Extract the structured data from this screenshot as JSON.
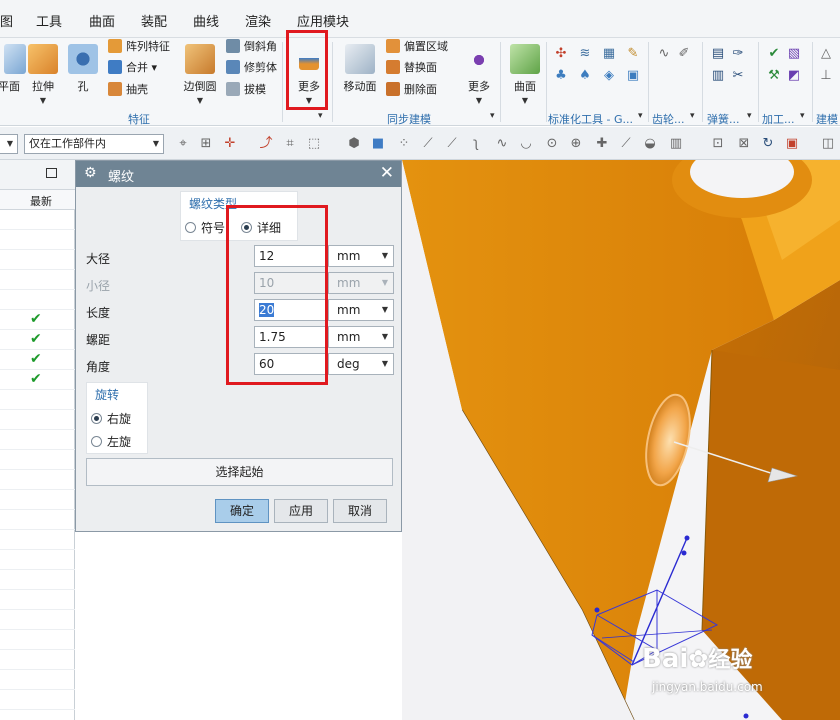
{
  "menu": [
    "图",
    "工具",
    "曲面",
    "装配",
    "曲线",
    "渲染",
    "应用模块"
  ],
  "ribbon": {
    "big_buttons": [
      "平面",
      "拉伸",
      "孔",
      "边倒圆",
      "更多",
      "移动面",
      "更多",
      "曲面"
    ],
    "small_buttons": {
      "feature_col": [
        "阵列特征",
        "合并",
        "抽壳"
      ],
      "detail_col": [
        "倒斜角",
        "修剪体",
        "拔模"
      ],
      "sync_col": [
        "偏置区域",
        "替换面",
        "删除面"
      ]
    },
    "groups": [
      "特征",
      "同步建模",
      "标准化工具 - G...",
      "齿轮...",
      "弹簧...",
      "加工...",
      "建模"
    ]
  },
  "toolbar": {
    "filter_left": "",
    "scope": "仅在工作部件内"
  },
  "navigator": {
    "column_header": "最新",
    "checked_rows": 4
  },
  "dialog": {
    "title": "螺纹",
    "thread_type": {
      "title": "螺纹类型",
      "option_symbol": "符号",
      "option_detail": "详细",
      "selected": "详细"
    },
    "fields": [
      {
        "label": "大径",
        "value": "12",
        "unit": "mm",
        "enabled": true
      },
      {
        "label": "小径",
        "value": "10",
        "unit": "mm",
        "enabled": false
      },
      {
        "label": "长度",
        "value": "20",
        "unit": "mm",
        "enabled": true
      },
      {
        "label": "螺距",
        "value": "1.75",
        "unit": "mm",
        "enabled": true
      },
      {
        "label": "角度",
        "value": "60",
        "unit": "deg",
        "enabled": true
      }
    ],
    "rotation": {
      "title": "旋转",
      "option_right": "右旋",
      "option_left": "左旋",
      "selected": "右旋"
    },
    "select_start": "选择起始",
    "ok": "确定",
    "apply": "应用",
    "cancel": "取消"
  },
  "watermark": {
    "brand_a": "Bai",
    "brand_b": "经验",
    "url": "jingyan.baidu.com"
  },
  "colors": {
    "accent_red": "#e0191f",
    "part_orange": "#e08a12",
    "dialog_title": "#6f8494",
    "ok_button": "#a9cdea"
  }
}
